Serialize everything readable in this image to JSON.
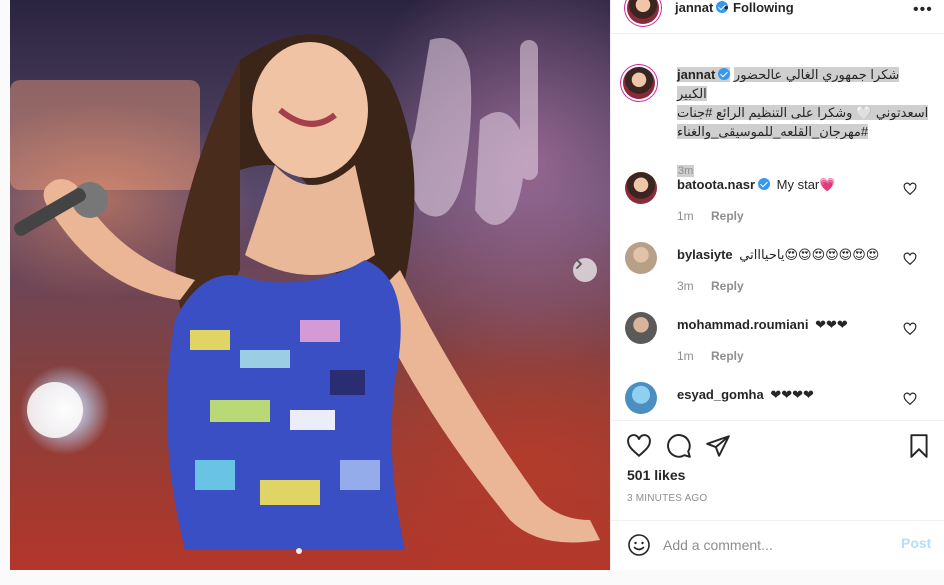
{
  "post": {
    "photo_alt": "",
    "carousel_next_icon": "chevron-right-icon"
  },
  "header": {
    "username": "jannat",
    "separator": "•",
    "follow_status": "Following",
    "more_icon": "ellipsis-icon",
    "more_glyph": "•••"
  },
  "caption": {
    "username": "jannat",
    "line1": "شكرا جمهوري الغالي عالحضور الكبير",
    "line2": "اسعدتوني 🤍 وشكرا على التنظيم الرائع #جنات",
    "line3": "#مهرجان_القلعه_للموسيقى_والغناء",
    "time": "3m"
  },
  "comments": [
    {
      "username": "batoota.nasr",
      "verified": true,
      "text": "My star💗",
      "time": "1m",
      "reply": "Reply"
    },
    {
      "username": "bylasiyte",
      "verified": false,
      "text": "ياحياااتي😍😍😍😍😍😍😍",
      "time": "3m",
      "reply": "Reply"
    },
    {
      "username": "mohammad.roumiani",
      "verified": false,
      "text": "❤❤❤",
      "time": "1m",
      "reply": "Reply"
    },
    {
      "username": "esyad_gomha",
      "verified": false,
      "text": "❤❤❤❤",
      "time": "",
      "reply": ""
    }
  ],
  "actions": {
    "like_icon": "heart-icon",
    "comment_icon": "comment-bubble-icon",
    "share_icon": "paper-plane-icon",
    "save_icon": "bookmark-icon"
  },
  "likes": "501 likes",
  "time_ago": "3 MINUTES AGO",
  "add_comment": {
    "placeholder": "Add a comment...",
    "post_label": "Post",
    "emoji_icon": "smiley-icon"
  },
  "colors": {
    "verified": "#3897f0",
    "post_disabled": "#b2dffc",
    "muted_text": "#8e8e8e"
  }
}
